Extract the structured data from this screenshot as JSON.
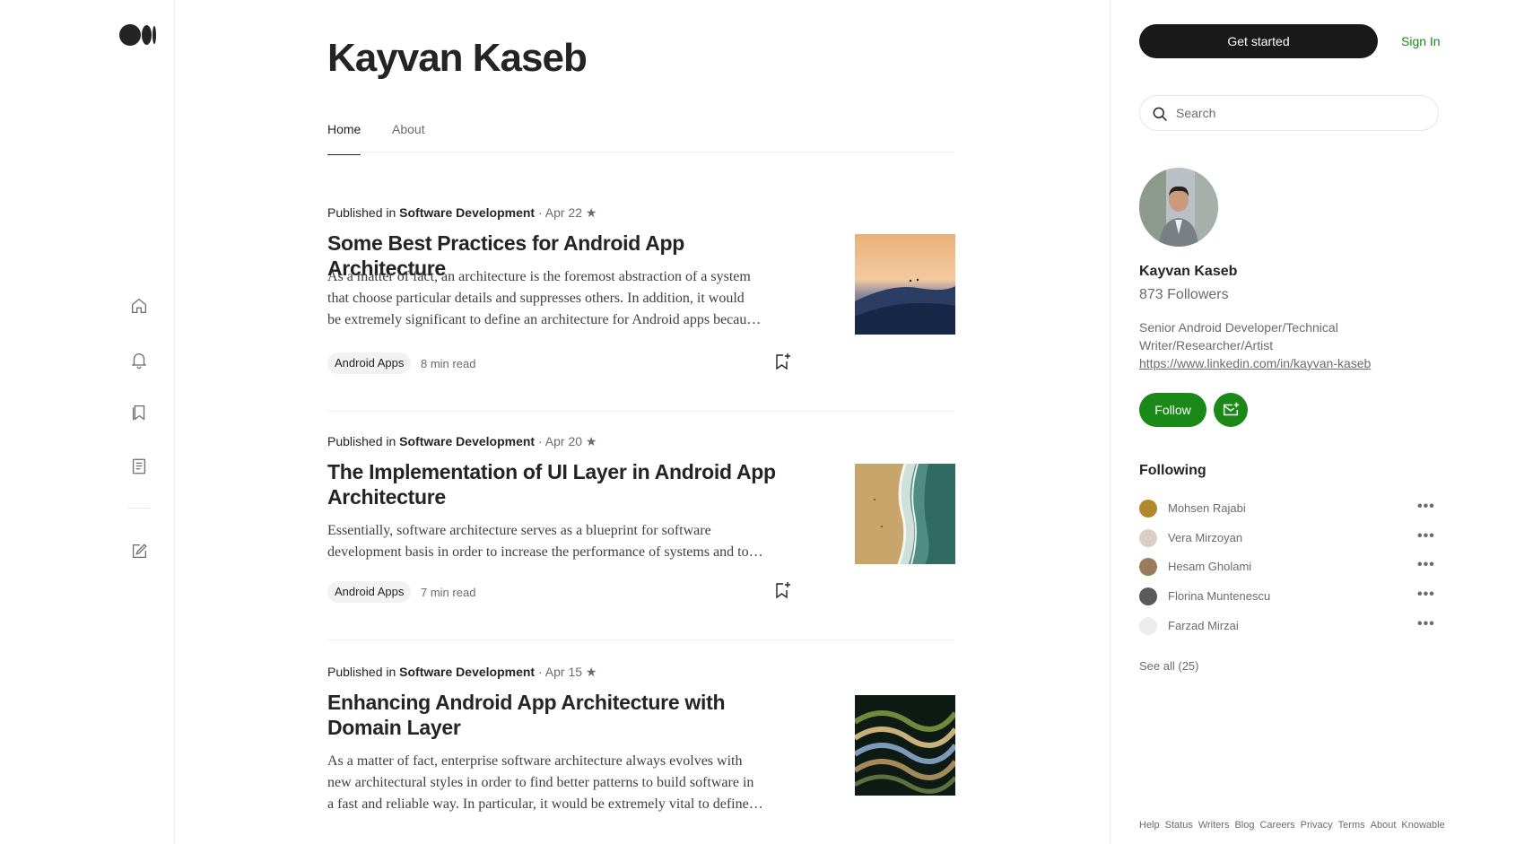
{
  "rail": {
    "items": [
      "home-icon",
      "notifications-icon",
      "library-icon",
      "stories-icon",
      "write-icon"
    ]
  },
  "author": {
    "name": "Kayvan Kaseb"
  },
  "tabs": [
    {
      "label": "Home"
    },
    {
      "label": "About"
    }
  ],
  "articles": [
    {
      "published_in_label": "Published in",
      "publication": "Software Development",
      "date": "· Apr 22",
      "star": "★",
      "title": "Some Best Practices for Android App Architecture",
      "excerpt": [
        "As a matter of fact, an architecture is the foremost abstraction of a system",
        "that choose particular details and suppresses others. In addition, it would",
        "be extremely significant to define an architecture for Android apps becau…"
      ],
      "tag": "Android Apps",
      "read_time": "8 min read"
    },
    {
      "published_in_label": "Published in",
      "publication": "Software Development",
      "date": "· Apr 20",
      "star": "★",
      "title": "The Implementation of UI Layer in Android App Architecture",
      "excerpt": [
        "Essentially, software architecture serves as a blueprint for software",
        "development basis in order to increase the performance of systems and to…"
      ],
      "tag": "Android Apps",
      "read_time": "7 min read"
    },
    {
      "published_in_label": "Published in",
      "publication": "Software Development",
      "date": "· Apr 15",
      "star": "★",
      "title": "Enhancing Android App Architecture with Domain Layer",
      "excerpt": [
        "As a matter of fact, enterprise software architecture always evolves with",
        "new architectural styles in order to find better patterns to build software in",
        "a fast and reliable way. In particular, it would be extremely vital to define…"
      ]
    }
  ],
  "sidebar": {
    "get_started": "Get started",
    "sign_in": "Sign In",
    "search_placeholder": "Search",
    "profile_name": "Kayvan Kaseb",
    "followers": "873 Followers",
    "bio_text": "Senior Android Developer/Technical Writer/Researcher/Artist",
    "bio_link": "https://www.linkedin.com/in/kayvan-kaseb",
    "follow": "Follow",
    "following_heading": "Following",
    "following": [
      {
        "name": "Mohsen Rajabi",
        "more": "•••"
      },
      {
        "name": "Vera Mirzoyan",
        "more": "•••"
      },
      {
        "name": "Hesam Gholami",
        "more": "•••"
      },
      {
        "name": "Florina Muntenescu",
        "more": "•••"
      },
      {
        "name": "Farzad Mirzai",
        "more": "•••"
      }
    ],
    "see_all": "See all (25)",
    "footer": [
      "Help",
      "Status",
      "Writers",
      "Blog",
      "Careers",
      "Privacy",
      "Terms",
      "About",
      "Knowable"
    ]
  },
  "colors": {
    "accent": "#1a8917",
    "dark_button": "#191919",
    "text": "#242424",
    "muted": "#6b6b6b"
  }
}
